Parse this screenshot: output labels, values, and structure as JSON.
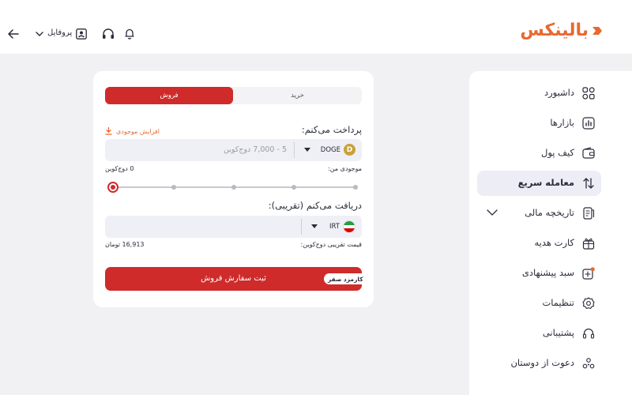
{
  "header": {
    "logo_text": "بالینکس",
    "profile_label": "پروفایل"
  },
  "sidebar": {
    "items": [
      {
        "label": "داشبورد",
        "icon": "grid-icon"
      },
      {
        "label": "بازارها",
        "icon": "market-chart-icon"
      },
      {
        "label": "کیف پول",
        "icon": "wallet-icon"
      },
      {
        "label": "معامله سریع",
        "icon": "swap-arrows-icon",
        "active": true
      },
      {
        "label": "تاریخچه مالی",
        "icon": "history-doc-icon"
      },
      {
        "label": "کارت هدیه",
        "icon": "gift-card-icon"
      },
      {
        "label": "سبد پیشنهادی",
        "icon": "basket-icon"
      },
      {
        "label": "تنظیمات",
        "icon": "settings-gear-icon"
      },
      {
        "label": "پشتیبانی",
        "icon": "support-headset-icon"
      },
      {
        "label": "دعوت از دوستان",
        "icon": "invite-friends-icon"
      }
    ]
  },
  "trade": {
    "tab_buy": "خرید",
    "tab_sell": "فروش",
    "pay_label": "پرداخت می‌کنم:",
    "add_balance": "افزایش موجودی",
    "pay_coin": "DOGE",
    "pay_coin_badge": "D",
    "pay_placeholder": "5 - 7,000 دوج‌کوین",
    "balance_label": "موجودی من:",
    "balance_value": "0 دوج‌کوین",
    "slider_percent": 0,
    "receive_label": "دریافت می‌کنم (تقریبی):",
    "receive_coin": "IRT",
    "price_label": "قیمت تقریبی دوج‌کوین:",
    "price_value": "16,913 تومان",
    "submit_label": "ثبت سفارش فروش",
    "fee_badge": "کارمزد صفر"
  },
  "colors": {
    "accent": "#cf2b2b",
    "brand": "#e8692f",
    "field_bg": "#efeff6",
    "active_nav_bg": "#ededf6"
  }
}
